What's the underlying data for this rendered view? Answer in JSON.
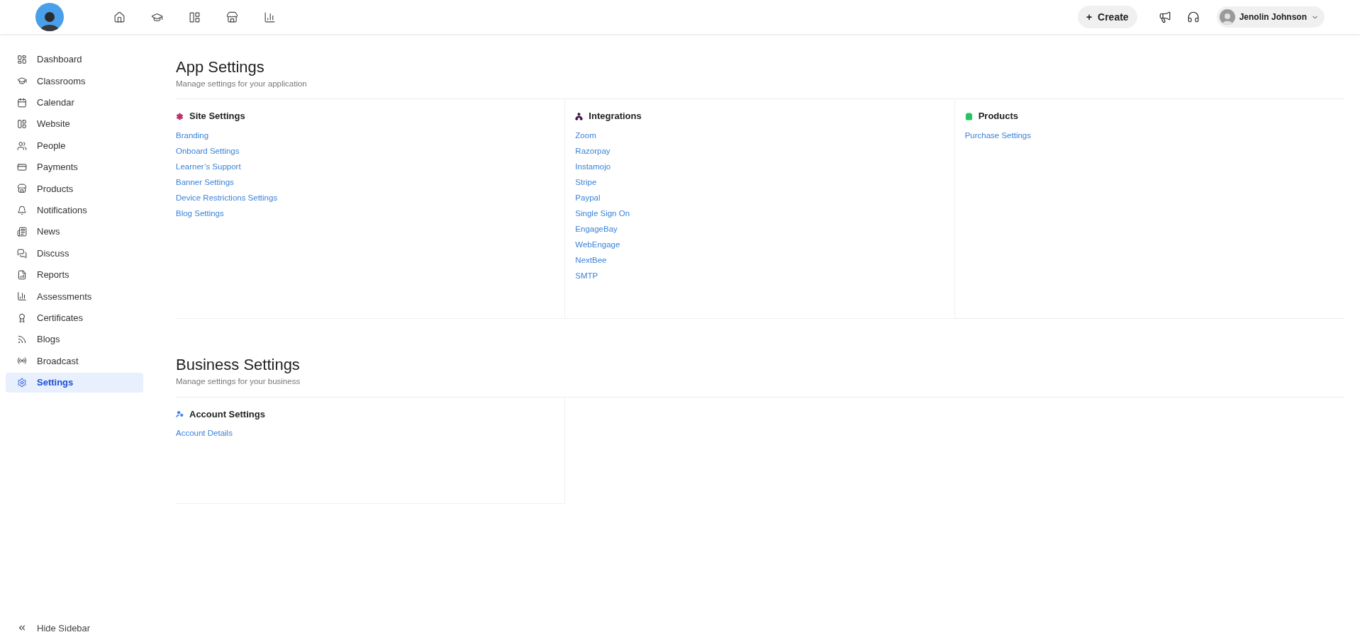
{
  "top_bar": {
    "create_button": {
      "icon": "+",
      "label": "Create"
    },
    "user": {
      "name": "Jenolin Johnson"
    }
  },
  "sidebar": {
    "items": [
      {
        "label": "Dashboard",
        "selected": false
      },
      {
        "label": "Classrooms",
        "selected": false
      },
      {
        "label": "Calendar",
        "selected": false
      },
      {
        "label": "Website",
        "selected": false
      },
      {
        "label": "People",
        "selected": false
      },
      {
        "label": "Payments",
        "selected": false
      },
      {
        "label": "Products",
        "selected": false
      },
      {
        "label": "Notifications",
        "selected": false
      },
      {
        "label": "News",
        "selected": false
      },
      {
        "label": "Discuss",
        "selected": false
      },
      {
        "label": "Reports",
        "selected": false
      },
      {
        "label": "Assessments",
        "selected": false
      },
      {
        "label": "Certificates",
        "selected": false
      },
      {
        "label": "Blogs",
        "selected": false
      },
      {
        "label": "Broadcast",
        "selected": false
      },
      {
        "label": "Settings",
        "selected": true
      }
    ],
    "hide_sidebar": "Hide Sidebar"
  },
  "sections": [
    {
      "title": "App Settings",
      "subtitle": "Manage settings for your application",
      "groups": [
        {
          "title": "Site Settings",
          "color": "#c0306a",
          "links": [
            "Branding",
            "Onboard Settings",
            "Learner’s Support",
            "Banner Settings",
            "Device Restrictions Settings",
            "Blog Settings"
          ]
        },
        {
          "title": "Integrations",
          "color": "#3b0a45",
          "links": [
            "Zoom",
            "Razorpay",
            "Instamojo",
            "Stripe",
            "Paypal",
            "Single Sign On",
            "EngageBay",
            "WebEngage",
            "NextBee",
            "SMTP"
          ]
        },
        {
          "title": "Products",
          "color": "#22c55e",
          "links": [
            "Purchase Settings"
          ]
        }
      ]
    },
    {
      "title": "Business Settings",
      "subtitle": "Manage settings for your business",
      "groups": [
        {
          "title": "Account Settings",
          "color": "#3b82f6",
          "links": [
            "Account Details"
          ]
        }
      ]
    }
  ]
}
